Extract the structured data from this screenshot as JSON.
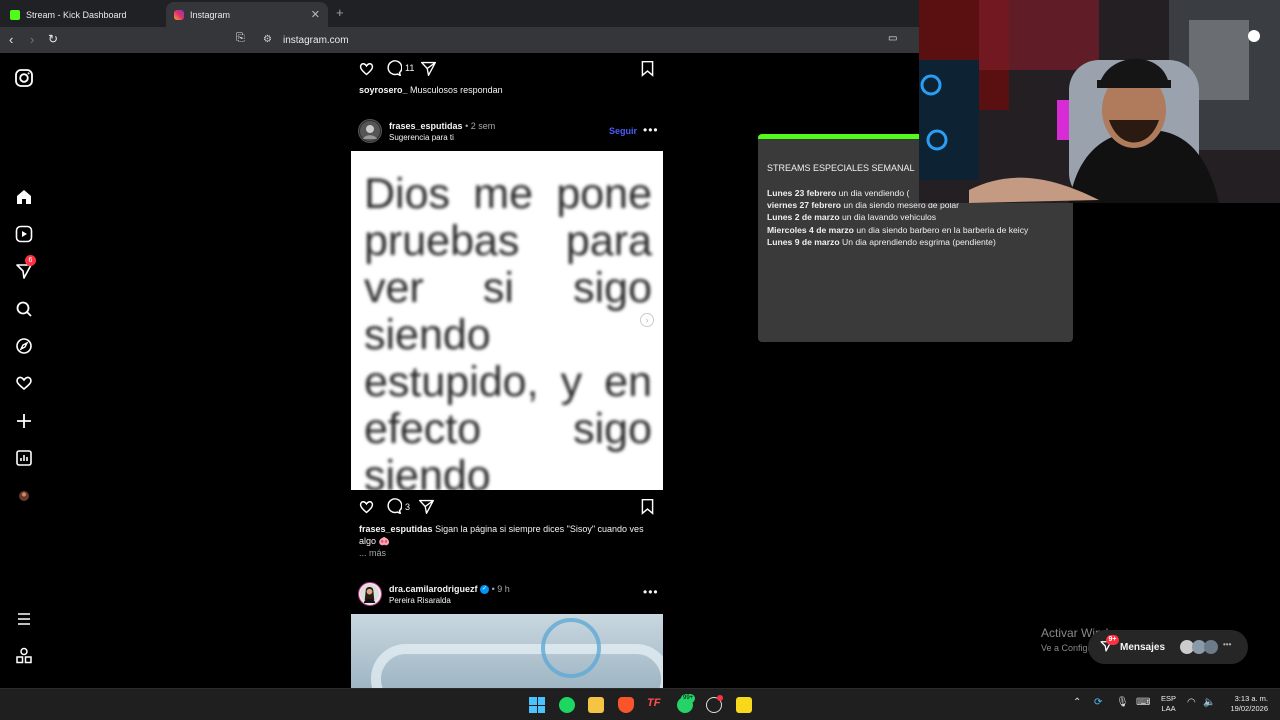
{
  "browser": {
    "tabs": [
      {
        "label": "Stream - Kick Dashboard"
      },
      {
        "label": "Instagram"
      }
    ],
    "url": "instagram.com"
  },
  "nav": {
    "notification_count": "6"
  },
  "post1": {
    "likes_comments": "11",
    "user": "soyrosero_",
    "caption": "Musculosos respondan"
  },
  "post2": {
    "user": "frases_esputidas",
    "age": "• 2 sem",
    "subtitle": "Sugerencia para ti",
    "follow": "Seguir",
    "image_text": "Dios me pone pruebas para ver si sigo siendo estupido, y en efecto sigo siendo",
    "comments": "3",
    "caption_user": "frases_esputidas",
    "caption": "Sigan la página si siempre dices \"Sisoy\" cuando ves algo 🐽",
    "more": "... más"
  },
  "post3": {
    "user": "dra.camilarodriguezf",
    "age": "• 9 h",
    "location": "Pereira Risaralda"
  },
  "streams": {
    "title": "STREAMS ESPECIALES SEMANAL",
    "items": [
      {
        "date": "Lunes 23 febrero",
        "desc": " un dia vendiendo ("
      },
      {
        "date": "viernes 27 febrero",
        "desc": " un dia siendo mesero de polar"
      },
      {
        "date": "Lunes 2 de marzo",
        "desc": " un dia lavando vehiculos"
      },
      {
        "date": "Miercoles 4 de marzo",
        "desc": " un dia siendo barbero en la barberia de keicy"
      },
      {
        "date": "Lunes 9 de marzo",
        "desc": " Un dia aprendiendo esgrima (pendiente)"
      }
    ]
  },
  "windows": {
    "activate": "Activar Windows",
    "activate_sub": "Ve a Configuración para activar Windows.",
    "messages": "Mensajes",
    "messages_badge": "9+",
    "lang1": "ESP",
    "lang2": "LAA",
    "time": "3:13 a. m.",
    "date": "19/02/2026",
    "whatsapp_badge": "99+"
  },
  "colors": {
    "accent_green": "#53fc18",
    "ig_blue": "#4a5df9",
    "badge_red": "#ff3040"
  }
}
